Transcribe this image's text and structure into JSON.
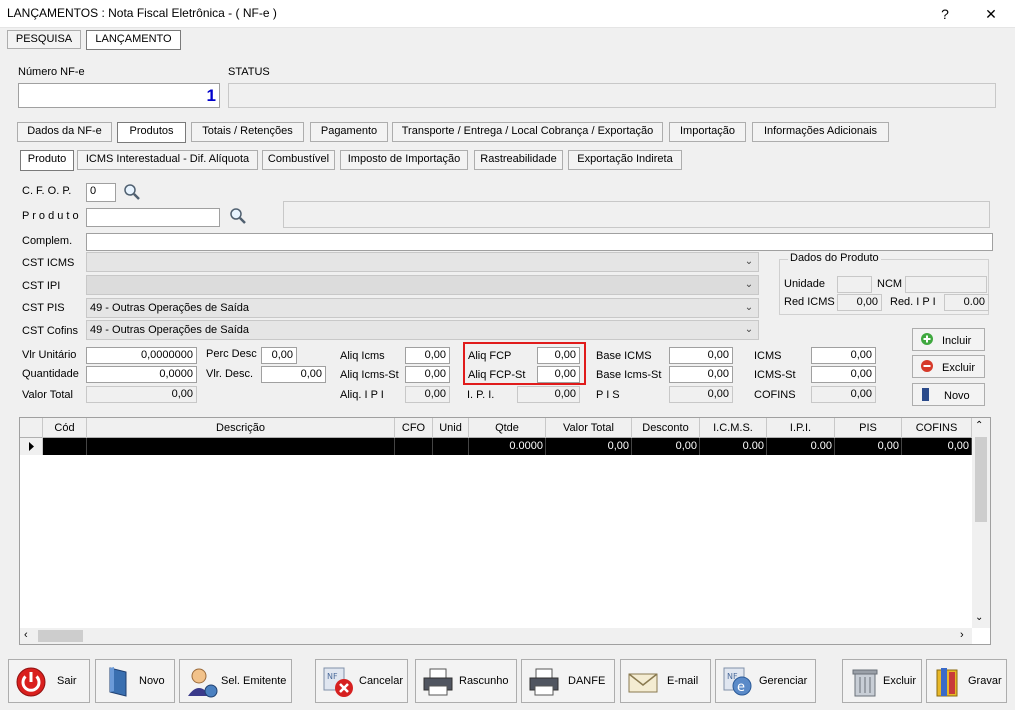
{
  "window": {
    "title": "LANÇAMENTOS : Nota Fiscal Eletrônica - ( NF-e )",
    "help_glyph": "?",
    "close_glyph": "✕"
  },
  "top_tabs": [
    "PESQUISA",
    "LANÇAMENTO"
  ],
  "header": {
    "numero_label": "Número NF-e",
    "numero_value": "1",
    "status_label": "STATUS",
    "status_value": ""
  },
  "main_tabs": [
    "Dados da NF-e",
    "Produtos",
    "Totais / Retenções",
    "Pagamento",
    "Transporte / Entrega / Local Cobrança / Exportação",
    "Importação",
    "Informações Adicionais"
  ],
  "sub_tabs": [
    "Produto",
    "ICMS Interestadual - Dif. Alíquota",
    "Combustível",
    "Imposto de Importação",
    "Rastreabilidade",
    "Exportação Indireta"
  ],
  "form": {
    "cfop_label": "C. F. O. P.",
    "cfop_value": "0",
    "produto_label": "P r o d u t o",
    "produto_value": "",
    "produto_desc": "",
    "complem_label": "Complem.",
    "complem_value": "",
    "cst_icms_label": "CST ICMS",
    "cst_icms_value": "",
    "cst_ipi_label": "CST IPI",
    "cst_ipi_value": "",
    "cst_pis_label": "CST PIS",
    "cst_pis_value": "49 - Outras Operações de Saída",
    "cst_cofins_label": "CST Cofins",
    "cst_cofins_value": "49 - Outras Operações de Saída"
  },
  "dados_produto": {
    "title": "Dados do Produto",
    "unidade_label": "Unidade",
    "unidade_value": "",
    "ncm_label": "NCM",
    "ncm_value": "",
    "red_icms_label": "Red ICMS",
    "red_icms_value": "0,00",
    "red_ipi_label": "Red. I P I",
    "red_ipi_value": "0.00"
  },
  "values": {
    "vlr_unitario_label": "Vlr Unitário",
    "vlr_unitario": "0,0000000",
    "quantidade_label": "Quantidade",
    "quantidade": "0,0000",
    "valor_total_label": "Valor Total",
    "valor_total": "0,00",
    "perc_desc_label": "Perc Desc",
    "perc_desc": "0,00",
    "vlr_desc_label": "Vlr. Desc.",
    "vlr_desc": "0,00",
    "aliq_icms_label": "Aliq Icms",
    "aliq_icms": "0,00",
    "aliq_icms_st_label": "Aliq Icms-St",
    "aliq_icms_st": "0,00",
    "aliq_ipi_label": "Aliq. I P I",
    "aliq_ipi": "0,00",
    "aliq_fcp_label": "Aliq FCP",
    "aliq_fcp": "0,00",
    "aliq_fcp_st_label": "Aliq FCP-St",
    "aliq_fcp_st": "0,00",
    "ipi_label": "I. P. I.",
    "ipi": "0,00",
    "base_icms_label": "Base ICMS",
    "base_icms": "0,00",
    "base_icms_st_label": "Base Icms-St",
    "base_icms_st": "0,00",
    "pis_label": "P I S",
    "pis": "0,00",
    "icms_label": "ICMS",
    "icms": "0,00",
    "icms_st_label": "ICMS-St",
    "icms_st": "0,00",
    "cofins_label": "COFINS",
    "cofins": "0,00"
  },
  "side_buttons": {
    "incluir": "Incluir",
    "excluir": "Excluir",
    "novo": "Novo"
  },
  "grid": {
    "columns": [
      "Cód",
      "Descrição",
      "CFO",
      "Unid",
      "Qtde",
      "Valor Total",
      "Desconto",
      "I.C.M.S.",
      "I.P.I.",
      "PIS",
      "COFINS"
    ],
    "row": [
      "",
      "",
      "",
      "",
      "0.0000",
      "0,00",
      "0,00",
      "0.00",
      "0.00",
      "0,00",
      "0,00"
    ]
  },
  "bottom_buttons": [
    "Sair",
    "Novo",
    "Sel. Emitente",
    "Cancelar",
    "Rascunho",
    "DANFE",
    "E-mail",
    "Gerenciar",
    "Excluir",
    "Gravar"
  ],
  "colors": {
    "accent_blue": "#0000cc",
    "highlight_red": "#e01b1b"
  }
}
